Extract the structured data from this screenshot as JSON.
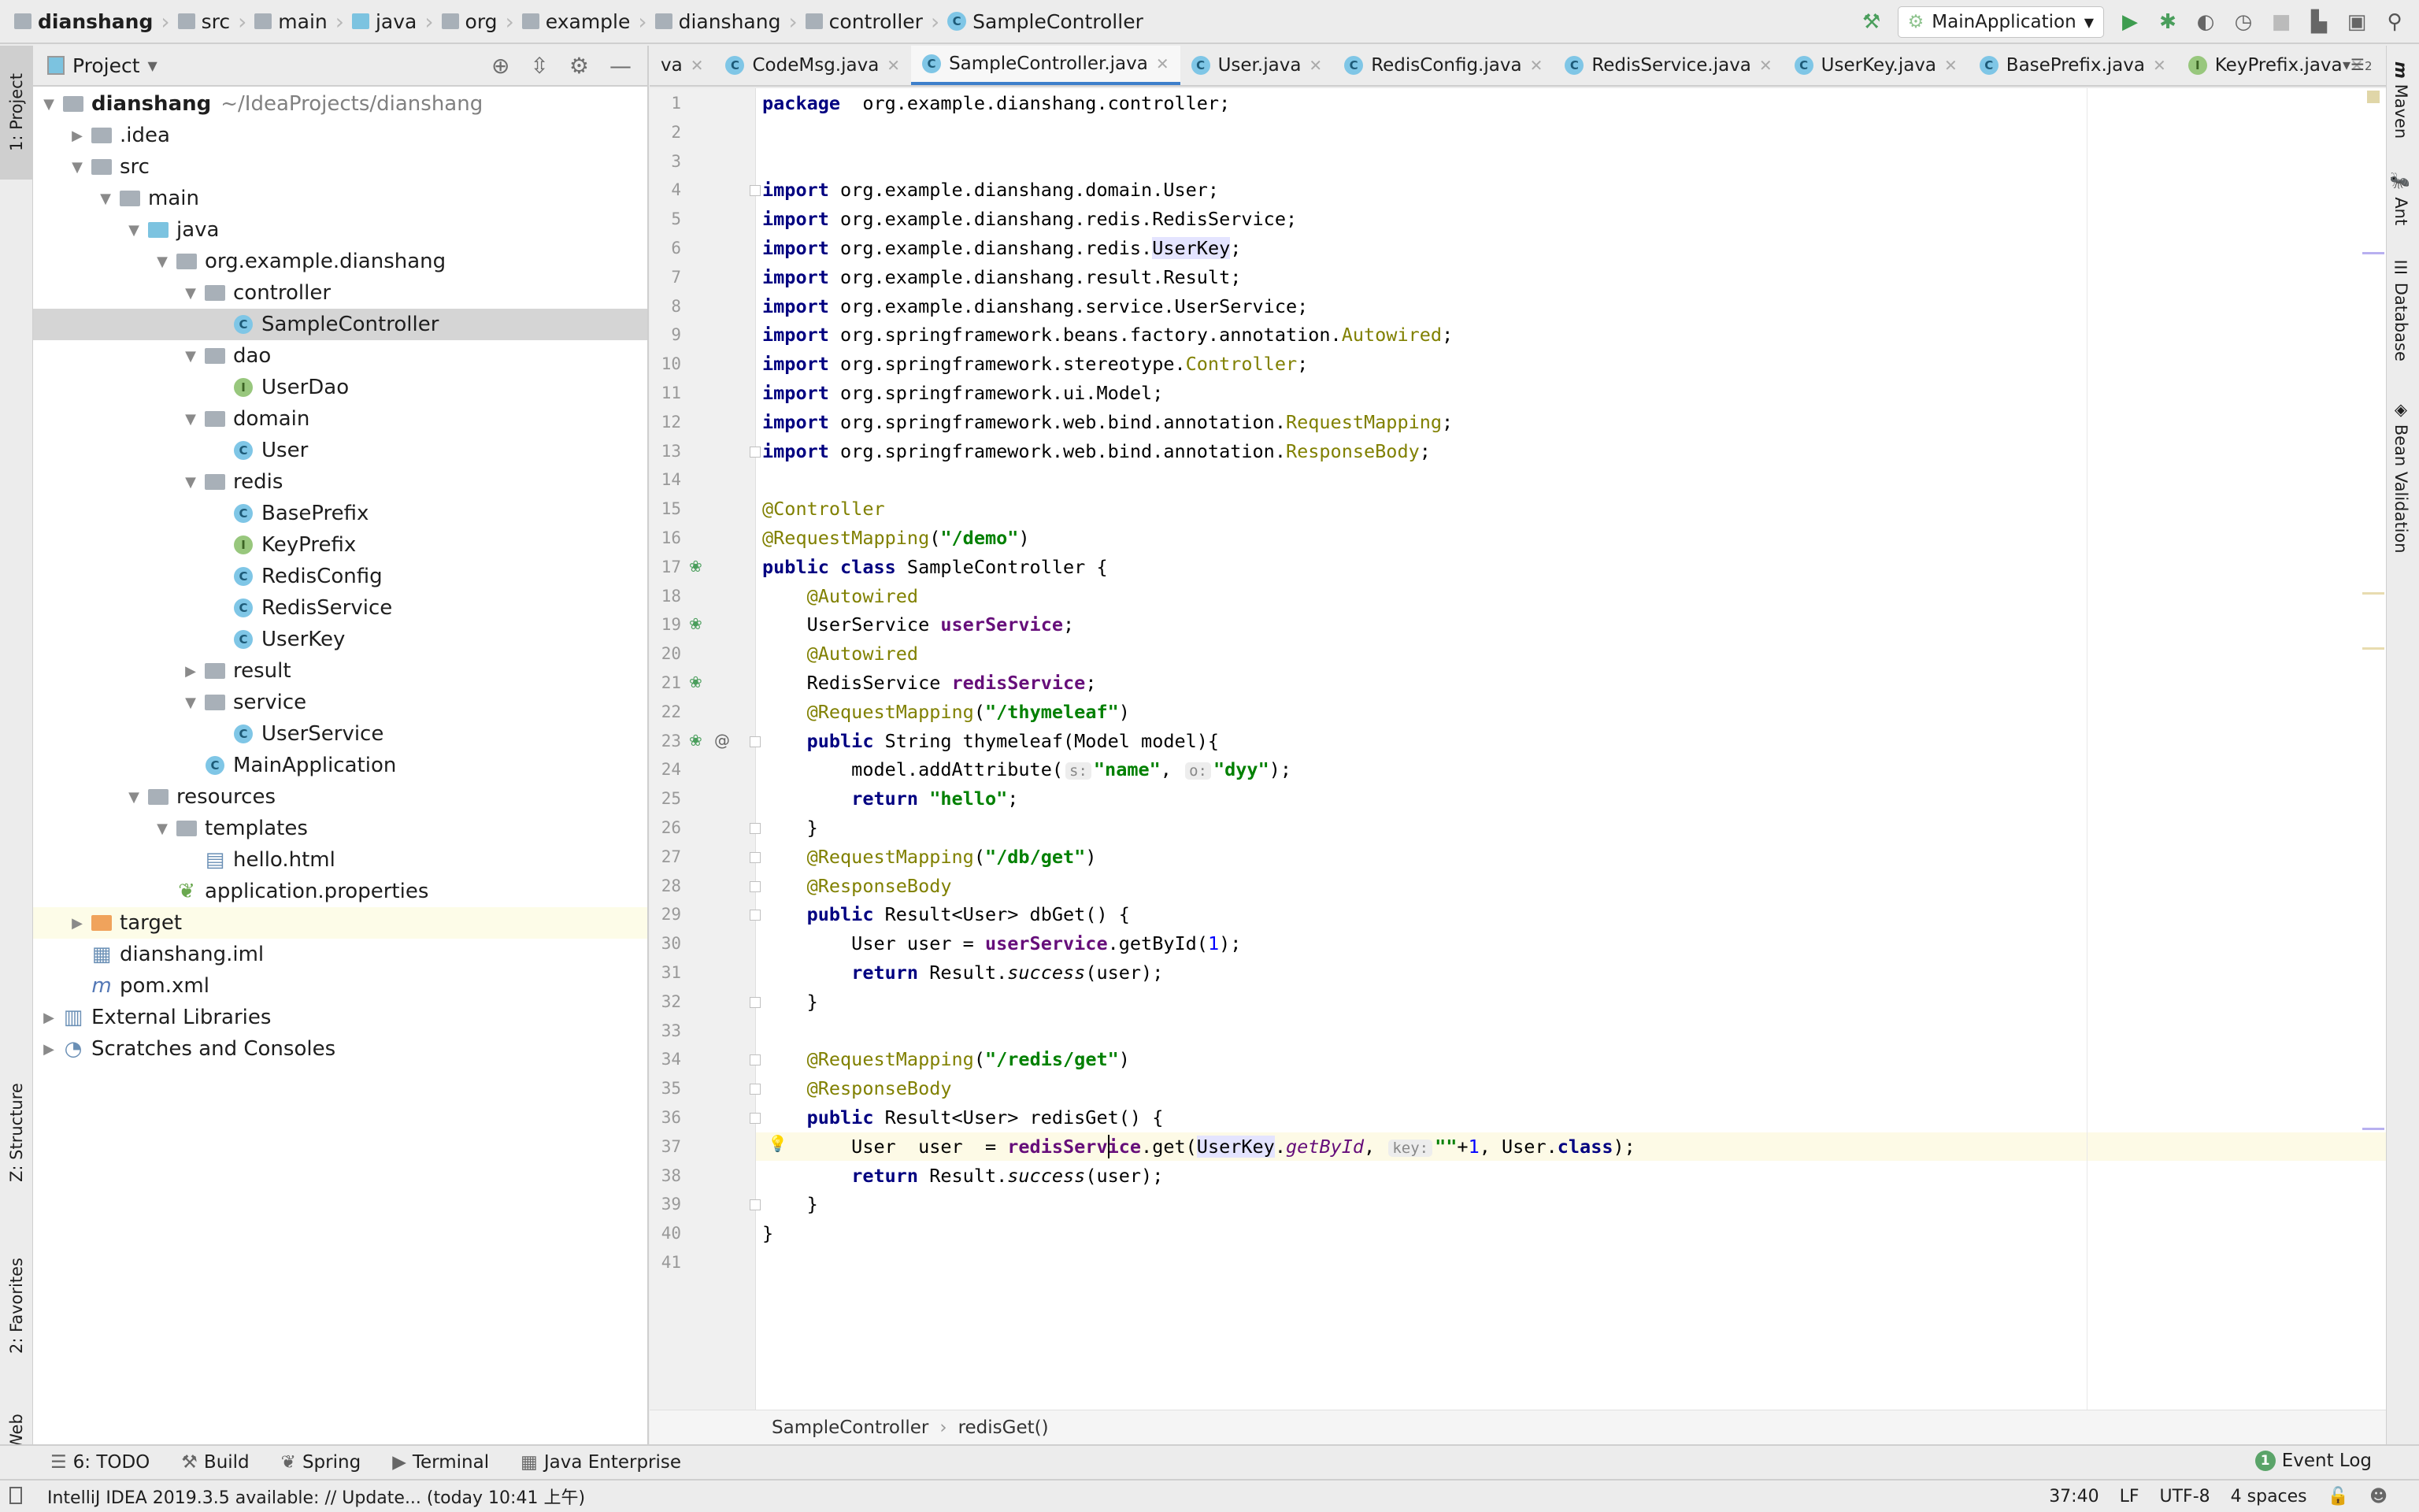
{
  "navbar": {
    "crumbs": [
      {
        "label": "dianshang",
        "icon": "project-folder-icon",
        "bold": true
      },
      {
        "label": "src",
        "icon": "folder-icon"
      },
      {
        "label": "main",
        "icon": "folder-icon"
      },
      {
        "label": "java",
        "icon": "source-folder-icon"
      },
      {
        "label": "org",
        "icon": "package-icon"
      },
      {
        "label": "example",
        "icon": "package-icon"
      },
      {
        "label": "dianshang",
        "icon": "package-icon"
      },
      {
        "label": "controller",
        "icon": "package-icon"
      },
      {
        "label": "SampleController",
        "icon": "class-icon"
      }
    ]
  },
  "toolbar": {
    "run_config": "MainApplication"
  },
  "left_stripe": {
    "project": "1: Project",
    "structure": "Z: Structure",
    "favorites": "2: Favorites",
    "web": "Web"
  },
  "right_stripe": {
    "maven": "Maven",
    "ant": "Ant",
    "database": "Database",
    "bean_validation": "Bean Validation"
  },
  "project_panel": {
    "title": "Project",
    "tree": [
      {
        "level": 0,
        "arrow": "down",
        "icon": "project",
        "label": "dianshang",
        "extra": "~/IdeaProjects/dianshang",
        "bold": true
      },
      {
        "level": 1,
        "arrow": "right",
        "icon": "folder",
        "label": ".idea"
      },
      {
        "level": 1,
        "arrow": "down",
        "icon": "folder",
        "label": "src"
      },
      {
        "level": 2,
        "arrow": "down",
        "icon": "folder",
        "label": "main"
      },
      {
        "level": 3,
        "arrow": "down",
        "icon": "folder-blue",
        "label": "java"
      },
      {
        "level": 4,
        "arrow": "down",
        "icon": "package",
        "label": "org.example.dianshang"
      },
      {
        "level": 5,
        "arrow": "down",
        "icon": "package",
        "label": "controller"
      },
      {
        "level": 6,
        "arrow": "",
        "icon": "class",
        "label": "SampleController",
        "selected": true
      },
      {
        "level": 5,
        "arrow": "down",
        "icon": "package",
        "label": "dao"
      },
      {
        "level": 6,
        "arrow": "",
        "icon": "interface",
        "label": "UserDao"
      },
      {
        "level": 5,
        "arrow": "down",
        "icon": "package",
        "label": "domain"
      },
      {
        "level": 6,
        "arrow": "",
        "icon": "class",
        "label": "User"
      },
      {
        "level": 5,
        "arrow": "down",
        "icon": "package",
        "label": "redis"
      },
      {
        "level": 6,
        "arrow": "",
        "icon": "class",
        "label": "BasePrefix"
      },
      {
        "level": 6,
        "arrow": "",
        "icon": "interface",
        "label": "KeyPrefix"
      },
      {
        "level": 6,
        "arrow": "",
        "icon": "class",
        "label": "RedisConfig"
      },
      {
        "level": 6,
        "arrow": "",
        "icon": "class",
        "label": "RedisService"
      },
      {
        "level": 6,
        "arrow": "",
        "icon": "class",
        "label": "UserKey"
      },
      {
        "level": 5,
        "arrow": "right",
        "icon": "package",
        "label": "result"
      },
      {
        "level": 5,
        "arrow": "down",
        "icon": "package",
        "label": "service"
      },
      {
        "level": 6,
        "arrow": "",
        "icon": "class",
        "label": "UserService"
      },
      {
        "level": 5,
        "arrow": "",
        "icon": "spring-class",
        "label": "MainApplication"
      },
      {
        "level": 3,
        "arrow": "down",
        "icon": "folder",
        "label": "resources"
      },
      {
        "level": 4,
        "arrow": "down",
        "icon": "folder",
        "label": "templates"
      },
      {
        "level": 5,
        "arrow": "",
        "icon": "html",
        "label": "hello.html"
      },
      {
        "level": 4,
        "arrow": "",
        "icon": "properties",
        "label": "application.properties"
      },
      {
        "level": 1,
        "arrow": "right",
        "icon": "folder-orange",
        "label": "target",
        "excluded": true
      },
      {
        "level": 1,
        "arrow": "",
        "icon": "iml",
        "label": "dianshang.iml"
      },
      {
        "level": 1,
        "arrow": "",
        "icon": "maven",
        "label": "pom.xml"
      },
      {
        "level": 0,
        "arrow": "right",
        "icon": "libraries",
        "label": "External Libraries"
      },
      {
        "level": 0,
        "arrow": "right",
        "icon": "scratches",
        "label": "Scratches and Consoles"
      }
    ]
  },
  "tabs": [
    {
      "label": "va",
      "icon": "",
      "partial": true
    },
    {
      "label": "CodeMsg.java",
      "icon": "class"
    },
    {
      "label": "SampleController.java",
      "icon": "class",
      "active": true
    },
    {
      "label": "User.java",
      "icon": "class"
    },
    {
      "label": "RedisConfig.java",
      "icon": "class"
    },
    {
      "label": "RedisService.java",
      "icon": "class"
    },
    {
      "label": "UserKey.java",
      "icon": "class"
    },
    {
      "label": "BasePrefix.java",
      "icon": "class"
    },
    {
      "label": "KeyPrefix.java",
      "icon": "interface"
    }
  ],
  "tabs_overflow": "2",
  "editor": {
    "current_line": 37,
    "lines": [
      [
        [
          "kw",
          "package"
        ],
        [
          "",
          "  org.example.dianshang.controller;"
        ]
      ],
      [],
      [],
      [
        [
          "kw",
          "import"
        ],
        [
          "",
          " org.example.dianshang.domain.User;"
        ]
      ],
      [
        [
          "kw",
          "import"
        ],
        [
          "",
          " org.example.dianshang.redis.RedisService;"
        ]
      ],
      [
        [
          "kw",
          "import"
        ],
        [
          "",
          " org.example.dianshang.redis."
        ],
        [
          "hl",
          "UserKey"
        ],
        [
          "",
          ";"
        ]
      ],
      [
        [
          "kw",
          "import"
        ],
        [
          "",
          " org.example.dianshang.result.Result;"
        ]
      ],
      [
        [
          "kw",
          "import"
        ],
        [
          "",
          " org.example.dianshang.service.UserService;"
        ]
      ],
      [
        [
          "kw",
          "import"
        ],
        [
          "",
          " org.springframework.beans.factory.annotation."
        ],
        [
          "ann",
          "Autowired"
        ],
        [
          "",
          ";"
        ]
      ],
      [
        [
          "kw",
          "import"
        ],
        [
          "",
          " org.springframework.stereotype."
        ],
        [
          "ann",
          "Controller"
        ],
        [
          "",
          ";"
        ]
      ],
      [
        [
          "kw",
          "import"
        ],
        [
          "",
          " org.springframework.ui.Model;"
        ]
      ],
      [
        [
          "kw",
          "import"
        ],
        [
          "",
          " org.springframework.web.bind.annotation."
        ],
        [
          "ann",
          "RequestMapping"
        ],
        [
          "",
          ";"
        ]
      ],
      [
        [
          "kw",
          "import"
        ],
        [
          "",
          " org.springframework.web.bind.annotation."
        ],
        [
          "ann",
          "ResponseBody"
        ],
        [
          "",
          ";"
        ]
      ],
      [],
      [
        [
          "ann",
          "@Controller"
        ]
      ],
      [
        [
          "ann",
          "@RequestMapping"
        ],
        [
          "",
          "("
        ],
        [
          "str",
          "\"/demo\""
        ],
        [
          "",
          ")"
        ]
      ],
      [
        [
          "kw",
          "public class"
        ],
        [
          "",
          " SampleController {"
        ]
      ],
      [
        [
          "",
          "    "
        ],
        [
          "ann",
          "@Autowired"
        ]
      ],
      [
        [
          "",
          "    UserService "
        ],
        [
          "fld",
          "userService"
        ],
        [
          "",
          ";"
        ]
      ],
      [
        [
          "",
          "    "
        ],
        [
          "ann",
          "@Autowired"
        ]
      ],
      [
        [
          "",
          "    RedisService "
        ],
        [
          "fld",
          "redisService"
        ],
        [
          "",
          ";"
        ]
      ],
      [
        [
          "",
          "    "
        ],
        [
          "ann",
          "@RequestMapping"
        ],
        [
          "",
          "("
        ],
        [
          "str",
          "\"/thymeleaf\""
        ],
        [
          "",
          ")"
        ]
      ],
      [
        [
          "",
          "    "
        ],
        [
          "kw",
          "public"
        ],
        [
          "",
          " String thymeleaf(Model model){"
        ]
      ],
      [
        [
          "",
          "        model.addAttribute("
        ],
        [
          "hint",
          "s:"
        ],
        [
          "str",
          "\"name\""
        ],
        [
          "",
          ", "
        ],
        [
          "hint",
          "o:"
        ],
        [
          "str",
          "\"dyy\""
        ],
        [
          "",
          ");"
        ]
      ],
      [
        [
          "",
          "        "
        ],
        [
          "kw",
          "return"
        ],
        [
          "",
          " "
        ],
        [
          "str",
          "\"hello\""
        ],
        [
          "",
          ";"
        ]
      ],
      [
        [
          "",
          "    }"
        ]
      ],
      [
        [
          "",
          "    "
        ],
        [
          "ann",
          "@RequestMapping"
        ],
        [
          "",
          "("
        ],
        [
          "str",
          "\"/db/get\""
        ],
        [
          "",
          ")"
        ]
      ],
      [
        [
          "",
          "    "
        ],
        [
          "ann",
          "@ResponseBody"
        ]
      ],
      [
        [
          "",
          "    "
        ],
        [
          "kw",
          "public"
        ],
        [
          "",
          " Result<User> dbGet() {"
        ]
      ],
      [
        [
          "",
          "        User user = "
        ],
        [
          "fld",
          "userService"
        ],
        [
          "",
          ".getById("
        ],
        [
          "num",
          "1"
        ],
        [
          "",
          ");"
        ]
      ],
      [
        [
          "",
          "        "
        ],
        [
          "kw",
          "return"
        ],
        [
          "",
          " Result."
        ],
        [
          "ita",
          "success"
        ],
        [
          "",
          "(user);"
        ]
      ],
      [
        [
          "",
          "    }"
        ]
      ],
      [],
      [
        [
          "",
          "    "
        ],
        [
          "ann",
          "@RequestMapping"
        ],
        [
          "",
          "("
        ],
        [
          "str",
          "\"/redis/get\""
        ],
        [
          "",
          ")"
        ]
      ],
      [
        [
          "",
          "    "
        ],
        [
          "ann",
          "@ResponseBody"
        ]
      ],
      [
        [
          "",
          "    "
        ],
        [
          "kw",
          "public"
        ],
        [
          "",
          " Result<User> redisGet() {"
        ]
      ],
      [
        [
          "",
          "        User  user  = "
        ],
        [
          "fld",
          "redisService"
        ],
        [
          "",
          ".get("
        ],
        [
          "hl",
          "UserKey"
        ],
        [
          "",
          "."
        ],
        [
          "sfld",
          "getById"
        ],
        [
          "",
          ", "
        ],
        [
          "hint",
          "key:"
        ],
        [
          "str",
          "\"\""
        ],
        [
          "",
          "+"
        ],
        [
          "num",
          "1"
        ],
        [
          "",
          ", User."
        ],
        [
          "kw",
          "class"
        ],
        [
          "",
          ");"
        ]
      ],
      [
        [
          "",
          "        "
        ],
        [
          "kw",
          "return"
        ],
        [
          "",
          " Result."
        ],
        [
          "ita",
          "success"
        ],
        [
          "",
          "(user);"
        ]
      ],
      [
        [
          "",
          "    }"
        ]
      ],
      [
        [
          "",
          "}"
        ]
      ],
      []
    ]
  },
  "editor_breadcrumb": {
    "class": "SampleController",
    "method": "redisGet()"
  },
  "bottom_tools": [
    {
      "label": "6: TODO",
      "icon": "todo-icon"
    },
    {
      "label": "Build",
      "icon": "hammer-icon"
    },
    {
      "label": "Spring",
      "icon": "spring-leaf-icon"
    },
    {
      "label": "Terminal",
      "icon": "terminal-icon"
    },
    {
      "label": "Java Enterprise",
      "icon": "java-enterprise-icon"
    }
  ],
  "event_log": {
    "count": "1",
    "label": "Event Log"
  },
  "status": {
    "message": "IntelliJ IDEA 2019.3.5 available: // Update... (today 10:41 上午)",
    "position": "37:40",
    "line_sep": "LF",
    "encoding": "UTF-8",
    "indent": "4 spaces"
  },
  "colors": {
    "accent": "#3d7fcb",
    "keyword": "#000080",
    "string": "#008000",
    "annotation": "#808000",
    "field": "#660e7a",
    "number": "#0000ff"
  }
}
